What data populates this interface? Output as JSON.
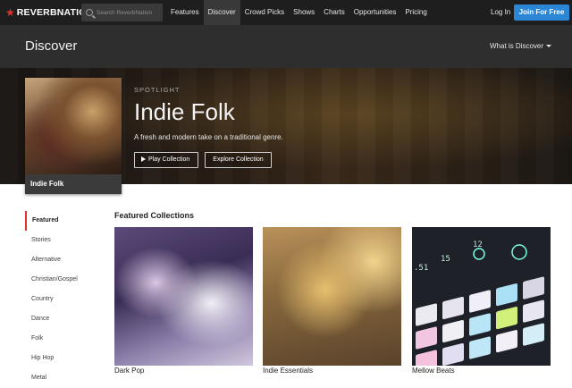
{
  "nav": {
    "logo": "REVERBNATION",
    "search_placeholder": "Search ReverbNation",
    "links": [
      "Features",
      "Discover",
      "Crowd Picks",
      "Shows",
      "Charts",
      "Opportunities",
      "Pricing"
    ],
    "active": "Discover",
    "login": "Log In",
    "join": "Join For Free",
    "accent": "#2b86d6",
    "brand_red": "#e2322b"
  },
  "discover_bar": {
    "title": "Discover",
    "what_is": "What is Discover"
  },
  "hero": {
    "kicker": "SPOTLIGHT",
    "title": "Indie Folk",
    "subtitle": "A fresh and modern take on a traditional genre.",
    "play_label": "Play Collection",
    "explore_label": "Explore Collection",
    "cover_caption": "Indie Folk"
  },
  "sidebar": {
    "items": [
      "Featured",
      "Stories",
      "Alternative",
      "Christian/Gospel",
      "Country",
      "Dance",
      "Folk",
      "Hip Hop",
      "Metal"
    ],
    "active": "Featured"
  },
  "featured": {
    "title": "Featured Collections",
    "tiles": [
      "Dark Pop",
      "Indie Essentials",
      "Mellow Beats"
    ]
  }
}
